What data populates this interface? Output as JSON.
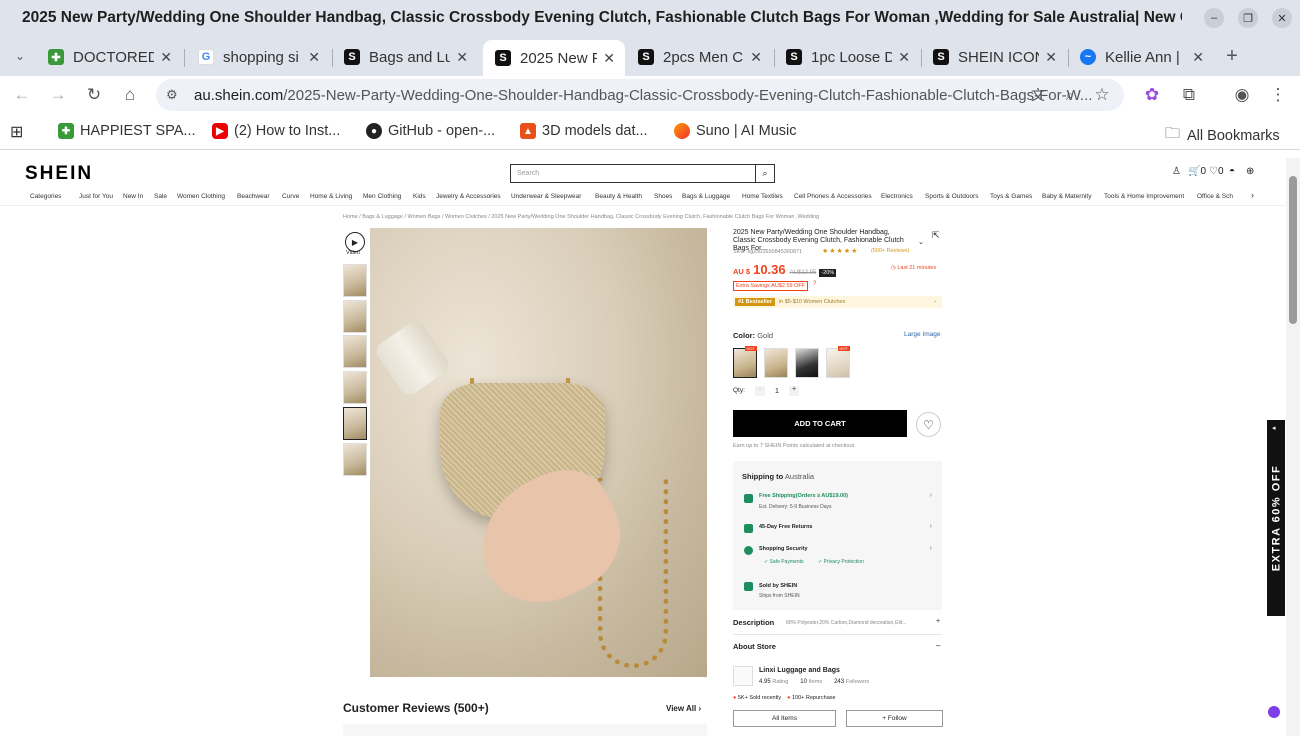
{
  "window": {
    "title": "2025 New Party/Wedding One Shoulder Handbag, Classic Crossbody Evening Clutch, Fashionable Clutch Bags For Woman ,Wedding for Sale Australia| New Collection O..."
  },
  "tabs": [
    {
      "label": "DOCTORED",
      "active": false
    },
    {
      "label": "shopping si",
      "active": false
    },
    {
      "label": "Bags and Lu",
      "active": false
    },
    {
      "label": "2025 New F",
      "active": true
    },
    {
      "label": "2pcs Men C",
      "active": false
    },
    {
      "label": "1pc Loose D",
      "active": false
    },
    {
      "label": "SHEIN ICON",
      "active": false
    },
    {
      "label": "Kellie Ann |",
      "active": false
    }
  ],
  "omnibox": {
    "host": "au.shein.com",
    "path": "/2025-New-Party-Wedding-One-Shoulder-Handbag-Classic-Crossbody-Evening-Clutch-Fashionable-Clutch-Bags-For-W..."
  },
  "bookmarks": [
    "HAPPIEST SPA...",
    "(2) How to Inst...",
    "GitHub - open-...",
    "3D models dat...",
    "Suno | AI Music"
  ],
  "all_bookmarks": "All Bookmarks",
  "shein": {
    "logo": "SHEIN",
    "search_placeholder": "Search",
    "header_counts": {
      "cart": "0",
      "wish": "0"
    },
    "categories": [
      "Categories",
      "Just for You",
      "New In",
      "Sale",
      "Women Clothing",
      "Beachwear",
      "Curve",
      "Home & Living",
      "Men Clothing",
      "Kids",
      "Jewelry & Accessories",
      "Underwear & Sleepwear",
      "Beauty & Health",
      "Shoes",
      "Bags & Luggage",
      "Home Textiles",
      "Cell Phones & Accessories",
      "Electronics",
      "Sports & Outdoors",
      "Toys & Games",
      "Baby & Maternity",
      "Tools & Home Improvement",
      "Office & Sch"
    ],
    "breadcrumb": "Home / Bags & Luggage / Women Bags / Women Clutches / 2025 New Party/Wedding One Shoulder Handbag, Classic Crossbody Evening Clutch, Fashionable Clutch Bags For Woman ,Wedding",
    "video_label": "Video",
    "product": {
      "title": "2025 New Party/Wedding One Shoulder Handbag, Classic Crossbody Evening Clutch, Fashionable Clutch Bags For...",
      "sku": "SKU: sg2501650845360871",
      "reviews": "(500+ Reviews)",
      "currency": "AU $",
      "price": "10.36",
      "old_price": "AU$12.95",
      "discount": "-20%",
      "timer": "Last 21 minutes",
      "extra_savings": "Extra Savings AU$2.59 OFF",
      "bestseller_tag": "#1 Bestseller",
      "bestseller_text": "in $5-$10 Women Clutches",
      "color_label": "Color:",
      "color_value": "Gold",
      "large_image": "Large Image",
      "hot": "HOT",
      "qty_label": "Qty:",
      "qty_value": "1",
      "qty_minus": "-",
      "qty_plus": "+",
      "add_to_cart": "ADD TO CART",
      "points_text": "Earn up to 7 SHEIN Points calculated at checkout."
    },
    "shipping": {
      "label": "Shipping to",
      "country": "Australia",
      "free_shipping": "Free Shipping(Orders ≥ AU$19.00)",
      "delivery": "Est. Delivery: 5-9 Business Days",
      "returns": "45-Day Free Returns",
      "security": "Shopping Security",
      "safe_payments": "✓ Safe Payments",
      "privacy": "✓ Privacy Protection",
      "sold_by": "Sold by SHEIN",
      "ships_from": "Ships from SHEIN"
    },
    "description": {
      "label": "Description",
      "text": "80% Polyester,20% Carbon,Diamond decoration,Glit..."
    },
    "store": {
      "label": "About Store",
      "name": "Linxi Luggage and Bags",
      "rating": "4.95",
      "rating_label": "Rating",
      "items": "10",
      "items_label": "Items",
      "followers": "243",
      "followers_label": "Followers",
      "sold": "5K+ Sold recently",
      "repurchase": "100+ Repurchase",
      "all_items": "All Items",
      "follow": "+ Follow"
    },
    "reviews_title": "Customer Reviews (500+)",
    "view_all": "View All",
    "extra_banner": "EXTRA 60% OFF"
  },
  "colors": {
    "shein_orange": "#f2431d",
    "black": "#000000",
    "chrome_bg": "#dfe3eb"
  }
}
